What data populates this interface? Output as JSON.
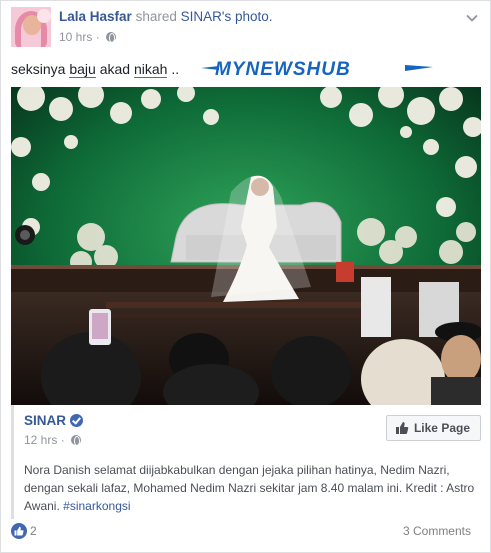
{
  "post": {
    "author": "Lala Hasfar",
    "verb": "shared",
    "page_name": "SINAR",
    "page_suffix": "'s",
    "object": "photo.",
    "time": "10 hrs",
    "privacy_icon": "globe-icon",
    "menu_icon": "chevron-down-icon"
  },
  "message": {
    "w1": "seksinya",
    "w2": "baju",
    "w3": "akad",
    "w4": "nikah",
    "w5": "..",
    "watermark": "MYNEWSHUB"
  },
  "shared": {
    "name": "SINAR",
    "time": "12 hrs",
    "like_page_label": "Like Page",
    "body": "Nora Danish selamat diijabkabulkan dengan jejaka pilihan hatinya, Nedim Nazri, dengan sekali lafaz, Mohamed Nedim Nazri sekitar jam 8.40 malam ini. Kredit : Astro Awani.",
    "hashtag": "#sinarkongsi"
  },
  "footer": {
    "like_count": "2",
    "comments": "3 Comments"
  },
  "colors": {
    "link": "#365899",
    "meta": "#90949c",
    "fb_blue": "#4267b2",
    "watermark": "#1565c0"
  }
}
